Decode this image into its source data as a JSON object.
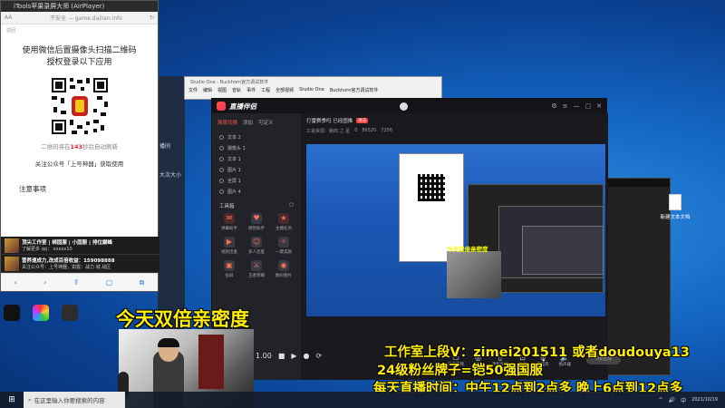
{
  "phone": {
    "window_title": "iTools苹果录屏大师 (AirPlayer)",
    "aa": "AA",
    "url": "不安全 — game.dailian.info",
    "back": "返回",
    "heading_line1": "使用微信后置摄像头扫描二维码",
    "heading_line2": "授权登录以下应用",
    "note_prefix": "二维码将在",
    "note_seconds": "143",
    "note_suffix": "秒后自动刷新",
    "follow": "关注公众号「上号神器」获取使用",
    "notice": "注意事项",
    "banner1_title": "顶尖工作室 | 绑固服 | 小固服 | 排位巅峰",
    "banner1_sub": "了解更多 qq：  xxxxx10",
    "banner2_title": "营养速成力,改成百倍收益：159098888",
    "banner2_sub": "关注公众号：上号神器，如需：战力 城 战区",
    "toolbar": [
      "‹",
      "›",
      "⇪",
      "▢",
      "⧉"
    ]
  },
  "studio": {
    "title": "Studio One - Buckhorn官方调试软件",
    "menu": [
      "文件",
      "编辑",
      "视图",
      "音轨",
      "事件",
      "工程",
      "全部视频",
      "Studio One",
      "Buckhorn官方调试软件"
    ]
  },
  "live_app": {
    "name": "直播伴侣",
    "tabs": [
      "场景切换",
      "添加",
      "可定义"
    ],
    "layers": [
      "文本 2",
      "摄像头 1",
      "文本 1",
      "图片 1",
      "全屏 1",
      "图片 4"
    ],
    "tools_title": "工具箱",
    "tools": [
      "弹幕助手",
      "感觉助手",
      "主播任务",
      "视频连麦",
      "多人连麦",
      "一键美颜",
      "投屏",
      "王者荣耀",
      "数码相片"
    ],
    "info_title": "打雷赛季吗 已经固推",
    "info_badge": "进击",
    "info_stats": [
      "工会资源：跑商 之 星",
      "0",
      "86520",
      "7256"
    ],
    "bottom_buttons": [
      "直播音频",
      "美颜",
      "手机投屏",
      "录屏",
      "麦克风",
      "扬声器"
    ],
    "bottom_pill": "开始直播",
    "preview_caption": "今天双倍亲密度"
  },
  "desktop": {
    "new_file_label": "新建文本文档",
    "side_labels": [
      "播间",
      "大次大小"
    ]
  },
  "overlay": {
    "caption": "今天双倍亲密度",
    "line1": "工作室上段V：zimei201511 或者doudouya13",
    "line2": "24级粉丝牌子=铠50强国服",
    "line3": "每天直播时间：中午12点到2点多 晚上6点到12点多"
  },
  "player": {
    "time": "1.00"
  },
  "taskbar": {
    "search_placeholder": "在这里输入你要搜索的内容",
    "tray_items": [
      "^",
      "🔊",
      "中"
    ],
    "clock_time": "",
    "clock_date": "2021/10/19"
  }
}
